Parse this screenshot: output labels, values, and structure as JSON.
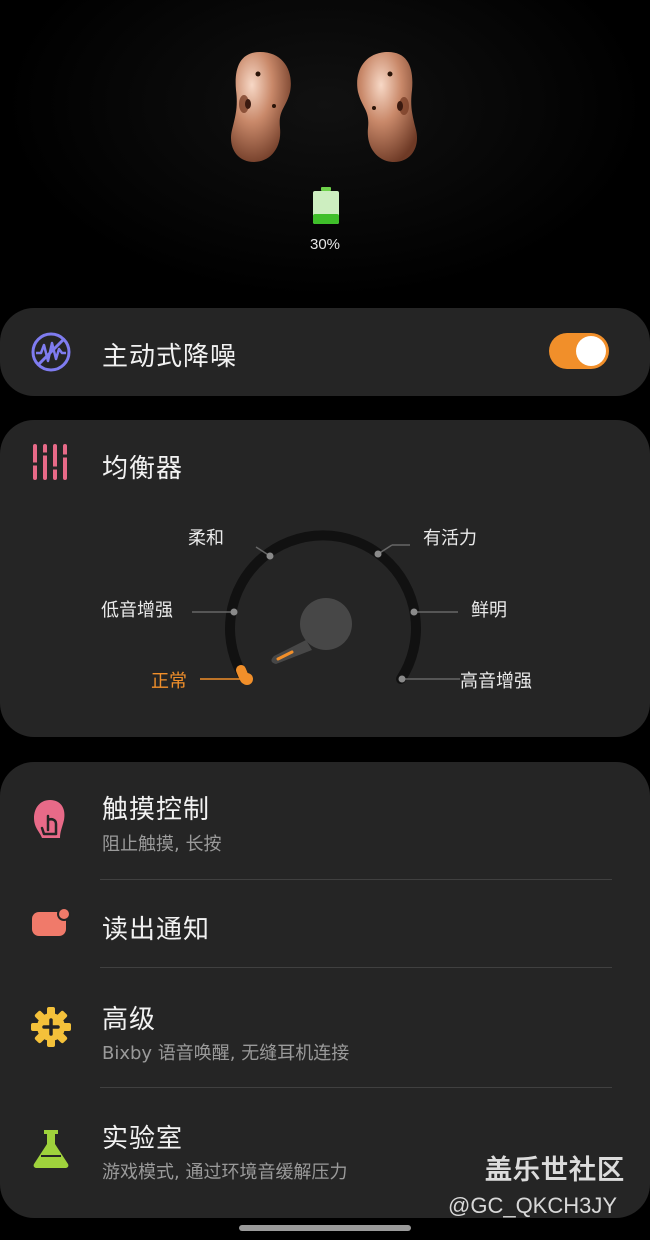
{
  "status": {
    "battery_percent": "30%",
    "battery_level": 0.3
  },
  "anc": {
    "title": "主动式降噪",
    "enabled": true,
    "icon": "noise-cancel-icon"
  },
  "equalizer": {
    "title": "均衡器",
    "icon": "equalizer-icon",
    "presets": [
      "正常",
      "低音增强",
      "柔和",
      "有活力",
      "鲜明",
      "高音增强"
    ],
    "selected": "正常"
  },
  "settings": [
    {
      "title": "触摸控制",
      "subtitle": "阻止触摸, 长按",
      "icon": "touch-icon"
    },
    {
      "title": "读出通知",
      "subtitle": "",
      "icon": "notification-icon"
    },
    {
      "title": "高级",
      "subtitle": "Bixby 语音唤醒, 无缝耳机连接",
      "icon": "gear-plus-icon"
    },
    {
      "title": "实验室",
      "subtitle": "游戏模式, 通过环境音缓解压力",
      "icon": "flask-icon"
    }
  ],
  "watermark": {
    "title": "盖乐世社区",
    "handle": "@GC_QKCH3JY"
  },
  "colors": {
    "accent": "#f18f2a",
    "card": "#252525",
    "anc_icon": "#7f7cf0",
    "eq_icon": "#e86a88",
    "touch_icon": "#e86a88",
    "notify_icon": "#f07a6a",
    "advanced_icon": "#f4c13a",
    "lab_icon": "#9fd23c",
    "battery": "#6ed24a"
  }
}
